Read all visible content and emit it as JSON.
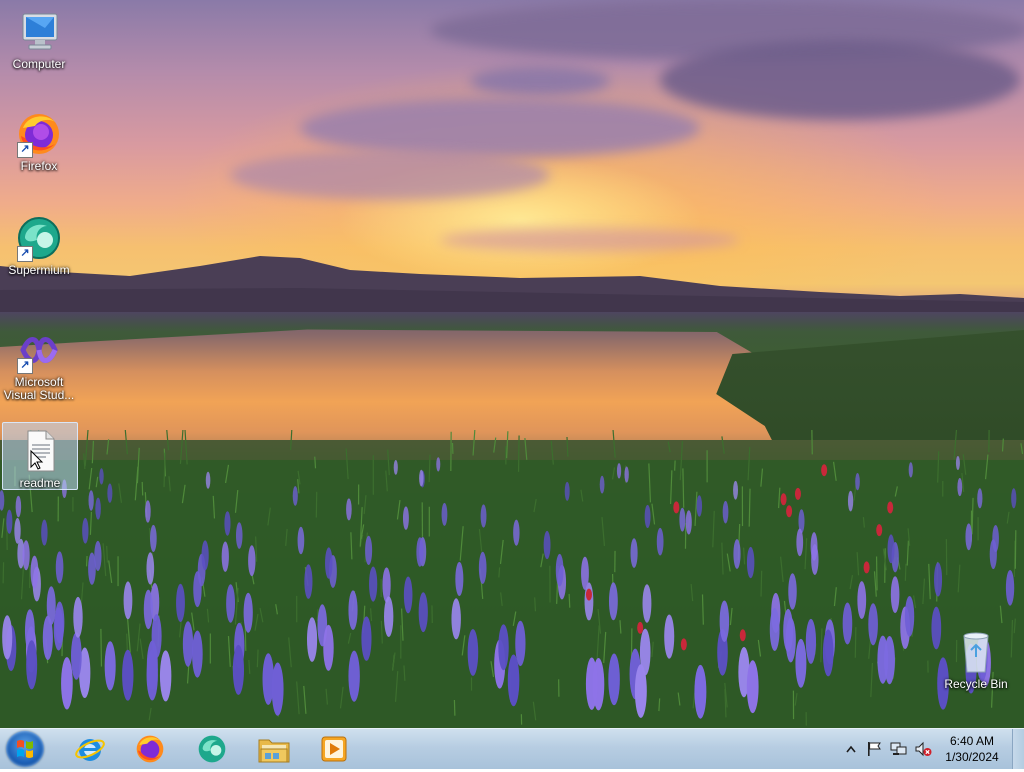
{
  "desktop": {
    "icons": [
      {
        "label": "Computer",
        "icon": "computer-icon"
      },
      {
        "label": "Firefox",
        "icon": "firefox-icon"
      },
      {
        "label": "Supermium",
        "icon": "supermium-icon"
      },
      {
        "label": "Microsoft Visual Stud...",
        "icon": "visual-studio-icon"
      },
      {
        "label": "readme",
        "icon": "text-file-icon"
      },
      {
        "label": "Recycle Bin",
        "icon": "recycle-bin-icon"
      }
    ]
  },
  "taskbar": {
    "start": {
      "icon": "windows-start-icon"
    },
    "pinned": [
      {
        "name": "Internet Explorer",
        "icon": "internet-explorer-icon"
      },
      {
        "name": "Firefox",
        "icon": "firefox-icon"
      },
      {
        "name": "Supermium",
        "icon": "supermium-icon"
      },
      {
        "name": "Windows Explorer",
        "icon": "folder-icon"
      },
      {
        "name": "Windows Media Player",
        "icon": "media-player-icon"
      }
    ],
    "tray": {
      "icons": [
        "show-hidden-icons-icon",
        "action-center-flag-icon",
        "network-icon",
        "volume-muted-icon"
      ],
      "time": "6:40 AM",
      "date": "1/30/2024"
    }
  },
  "colors": {
    "taskbar": "#b7cde2",
    "selection": "#bed7f5"
  }
}
